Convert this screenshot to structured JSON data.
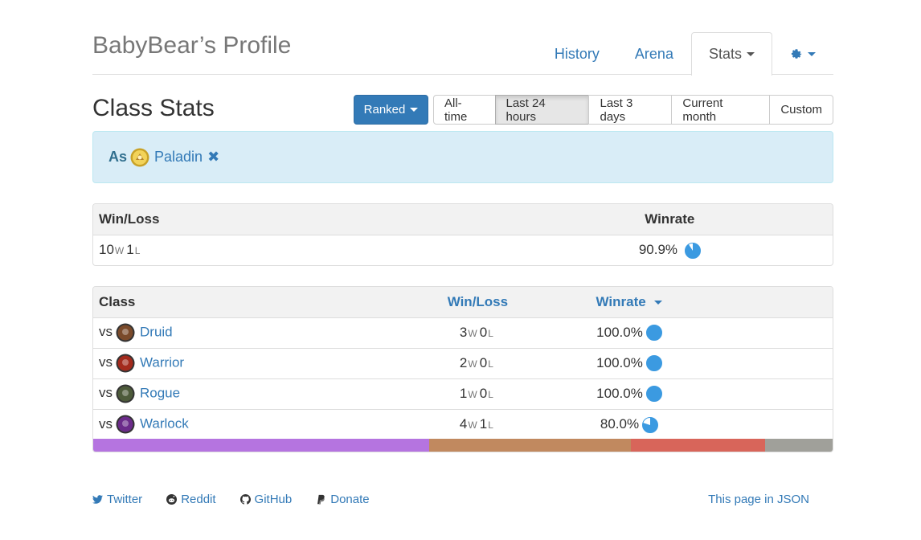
{
  "header": {
    "profile_title": "BabyBear’s Profile",
    "nav": {
      "history": "History",
      "arena": "Arena",
      "stats": "Stats"
    }
  },
  "class_stats": {
    "title": "Class Stats",
    "mode_button": "Ranked",
    "ranges": [
      "All-time",
      "Last 24 hours",
      "Last 3 days",
      "Current month",
      "Custom"
    ],
    "active_range": "Last 24 hours"
  },
  "filter": {
    "prefix": "As",
    "class_name": "Paladin"
  },
  "summary": {
    "headers": {
      "winloss": "Win/Loss",
      "winrate": "Winrate"
    },
    "wins": "10",
    "losses": "1",
    "win_unit": "W",
    "loss_unit": "L",
    "winrate": "90.9%",
    "winrate_fraction": 0.909
  },
  "matchups": {
    "headers": {
      "class": "Class",
      "winloss": "Win/Loss",
      "winrate": "Winrate"
    },
    "rows": [
      {
        "vs": "vs",
        "class": "Druid",
        "wins": "3",
        "losses": "0",
        "winrate": "100.0%",
        "fraction": 1.0,
        "icon_color": "#7a4a2a"
      },
      {
        "vs": "vs",
        "class": "Warrior",
        "wins": "2",
        "losses": "0",
        "winrate": "100.0%",
        "fraction": 1.0,
        "icon_color": "#a32a1c"
      },
      {
        "vs": "vs",
        "class": "Rogue",
        "wins": "1",
        "losses": "0",
        "winrate": "100.0%",
        "fraction": 1.0,
        "icon_color": "#4d5a3a"
      },
      {
        "vs": "vs",
        "class": "Warlock",
        "wins": "4",
        "losses": "1",
        "winrate": "80.0%",
        "fraction": 0.8,
        "icon_color": "#6b2b8a"
      }
    ],
    "distribution": [
      {
        "class": "Warlock",
        "share": 0.4545,
        "color": "#b574e0"
      },
      {
        "class": "Druid",
        "share": 0.2727,
        "color": "#c1895f"
      },
      {
        "class": "Warrior",
        "share": 0.1818,
        "color": "#d8655a"
      },
      {
        "class": "Rogue",
        "share": 0.0909,
        "color": "#a0a09a"
      }
    ]
  },
  "footer": {
    "twitter": "Twitter",
    "reddit": "Reddit",
    "github": "GitHub",
    "donate": "Donate",
    "json": "This page in JSON"
  },
  "colors": {
    "link": "#337ab7",
    "pie": "#3b9ae1",
    "alert_bg": "#d9edf7"
  }
}
